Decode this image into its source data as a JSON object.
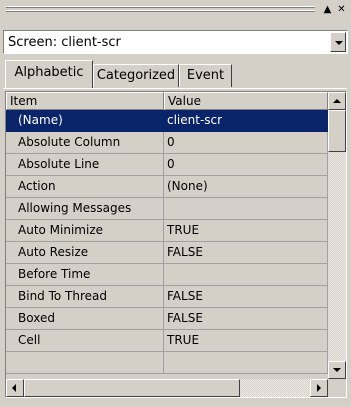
{
  "window": {
    "minimize_glyph": "▲",
    "close_glyph": "✕"
  },
  "screen_selector": {
    "value": "Screen:  client-scr"
  },
  "tabs": [
    {
      "label": "Alphabetic",
      "active": true
    },
    {
      "label": "Categorized",
      "active": false
    },
    {
      "label": "Event",
      "active": false
    }
  ],
  "grid": {
    "columns": [
      "Item",
      "Value"
    ],
    "rows": [
      {
        "item": "(Name)",
        "value": "client-scr",
        "selected": true
      },
      {
        "item": "Absolute Column",
        "value": "0"
      },
      {
        "item": "Absolute Line",
        "value": "0"
      },
      {
        "item": "Action",
        "value": "(None)"
      },
      {
        "item": "Allowing Messages",
        "value": ""
      },
      {
        "item": "Auto Minimize",
        "value": "TRUE"
      },
      {
        "item": "Auto Resize",
        "value": "FALSE"
      },
      {
        "item": "Before Time",
        "value": ""
      },
      {
        "item": "Bind To Thread",
        "value": "FALSE"
      },
      {
        "item": "Boxed",
        "value": "FALSE"
      },
      {
        "item": "Cell",
        "value": "TRUE"
      },
      {
        "item": "",
        "value": ""
      }
    ]
  },
  "colors": {
    "selection": "#0a246a",
    "face": "#d4d0c8"
  }
}
